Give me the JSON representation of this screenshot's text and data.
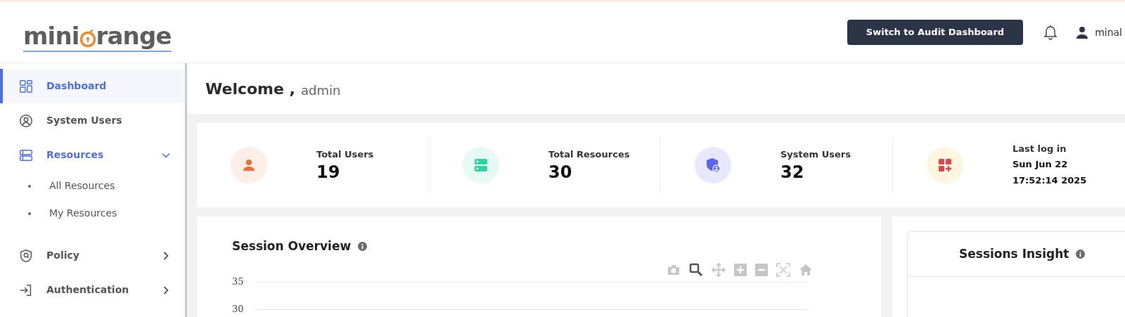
{
  "header": {
    "logo": {
      "left": "mini",
      "right": "range"
    },
    "switch_button": "Switch to Audit Dashboard",
    "user": "minal"
  },
  "sidebar": {
    "items": [
      {
        "kind": "link",
        "label": "Dashboard",
        "selected": true
      },
      {
        "kind": "link",
        "label": "System Users",
        "selected": false
      },
      {
        "kind": "group",
        "label": "Resources",
        "selected": true,
        "expanded": true,
        "children": [
          {
            "label": "All Resources"
          },
          {
            "label": "My Resources"
          }
        ]
      },
      {
        "kind": "group",
        "label": "Policy",
        "selected": false,
        "expanded": false
      },
      {
        "kind": "group",
        "label": "Authentication",
        "selected": false,
        "expanded": false
      }
    ]
  },
  "welcome": {
    "greeting": "Welcome ,",
    "name": "admin"
  },
  "stats": [
    {
      "color": "#f26b3a",
      "label": "Total Users",
      "value": "19"
    },
    {
      "color": "#2ed3a0",
      "label": "Total Resources",
      "value": "30"
    },
    {
      "color": "#5b63f0",
      "label": "System Users",
      "value": "32"
    },
    {
      "color": "#e0434f",
      "label": "Last log in",
      "lines": [
        "Sun Jun 22",
        "17:52:14 2025"
      ]
    }
  ],
  "session_overview": {
    "title": "Session Overview",
    "y_labels": [
      "35",
      "30"
    ]
  },
  "sessions_insight": {
    "title": "Sessions Insight"
  }
}
